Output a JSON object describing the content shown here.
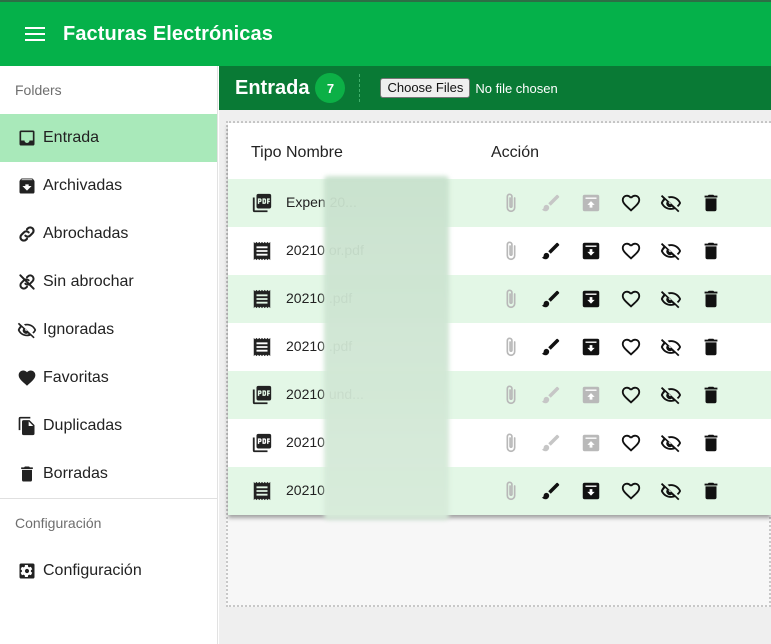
{
  "app": {
    "title": "Facturas Electrónicas"
  },
  "sidebar": {
    "folders_title": "Folders",
    "items": [
      {
        "label": "Entrada",
        "icon": "inbox-icon",
        "active": true
      },
      {
        "label": "Archivadas",
        "icon": "archive-icon"
      },
      {
        "label": "Abrochadas",
        "icon": "link-icon"
      },
      {
        "label": "Sin abrochar",
        "icon": "link-off-icon"
      },
      {
        "label": "Ignoradas",
        "icon": "eye-off-icon"
      },
      {
        "label": "Favoritas",
        "icon": "heart-icon"
      },
      {
        "label": "Duplicadas",
        "icon": "copy-icon"
      },
      {
        "label": "Borradas",
        "icon": "trash-icon"
      }
    ],
    "config_title": "Configuración",
    "config_item": {
      "label": "Configuración",
      "icon": "settings-icon"
    }
  },
  "header": {
    "title": "Entrada",
    "count": "7",
    "file_button": "Choose Files",
    "file_status": "No file chosen"
  },
  "table": {
    "columns": {
      "tipo": "Tipo",
      "nombre": "Nombre",
      "accion": "Acción"
    },
    "rows": [
      {
        "type": "pdf-icon",
        "name": "Expen 20...",
        "enabled": false
      },
      {
        "type": "receipt-icon",
        "name": "20210 or.pdf",
        "enabled": true
      },
      {
        "type": "receipt-icon",
        "name": "20210 .pdf",
        "enabled": true
      },
      {
        "type": "receipt-icon",
        "name": "20210 .pdf",
        "enabled": true
      },
      {
        "type": "pdf-icon",
        "name": "20210 und...",
        "enabled": false
      },
      {
        "type": "pdf-icon",
        "name": "20210",
        "enabled": false
      },
      {
        "type": "receipt-icon",
        "name": "20210",
        "enabled": true
      }
    ]
  },
  "colors": {
    "appbar": "#05b14a",
    "header": "#097a35",
    "active": "#a9e9ba",
    "row_alt": "#e3f7e6"
  }
}
